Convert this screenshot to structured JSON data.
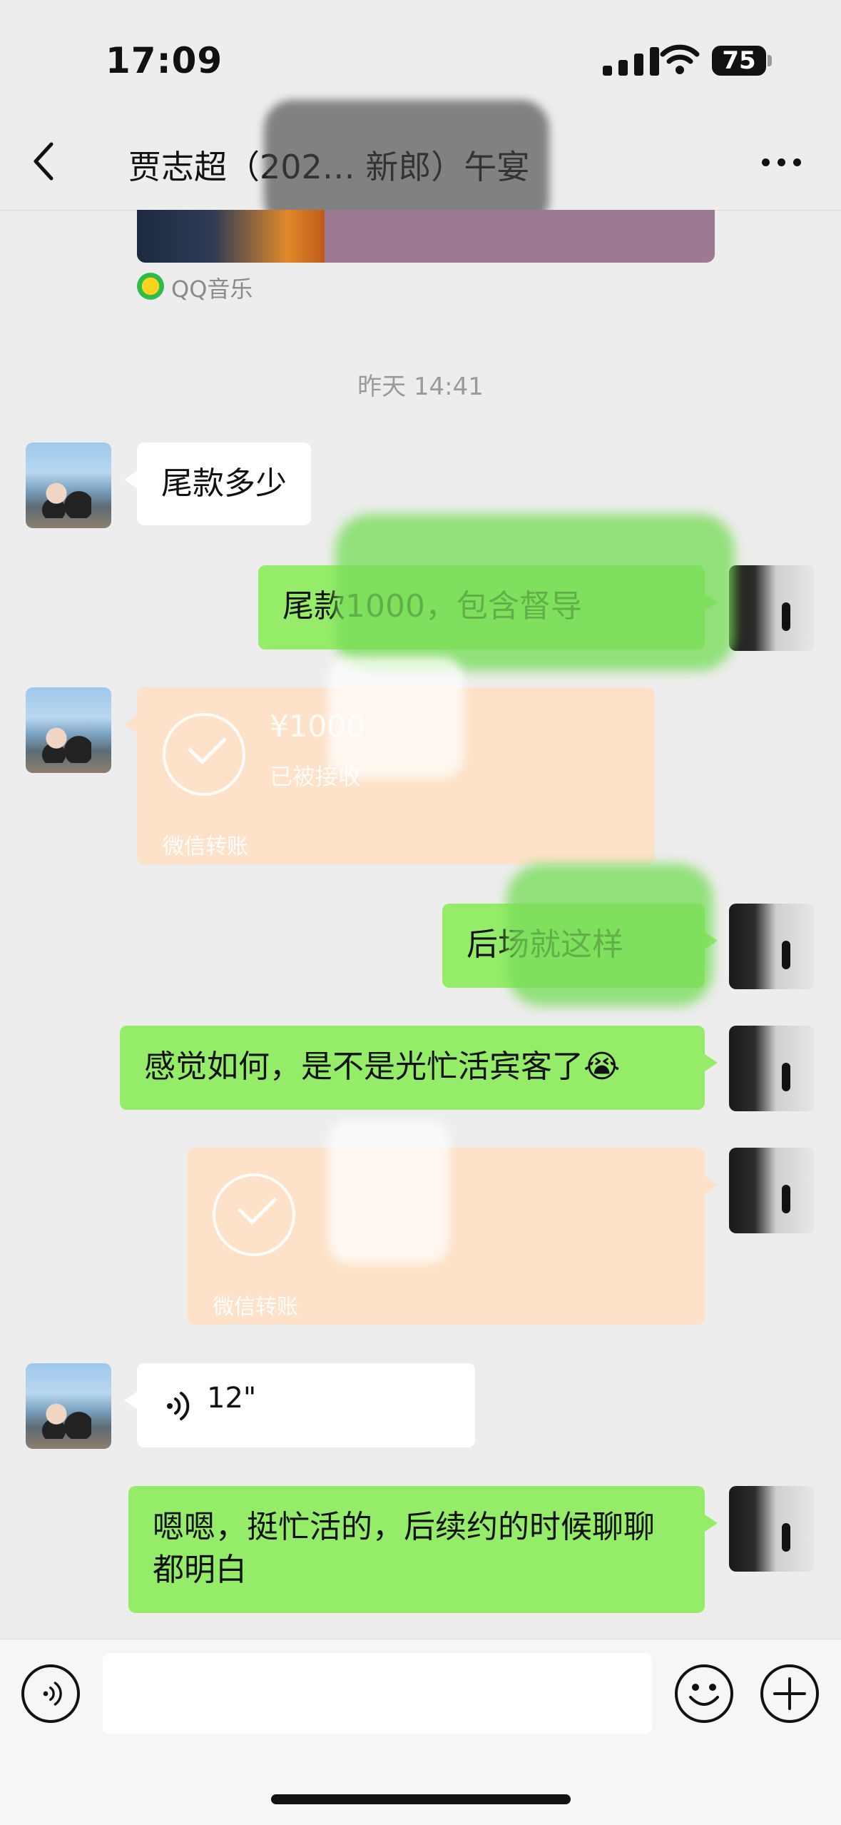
{
  "status_bar": {
    "time": "17:09",
    "battery": "75"
  },
  "nav": {
    "title": "贾志超（202… 新郎）午宴"
  },
  "music_card": {
    "source": "QQ音乐"
  },
  "timestamp": "昨天 14:41",
  "messages": [
    {
      "side": "in",
      "type": "text",
      "text": "尾款多少"
    },
    {
      "side": "out",
      "type": "text",
      "text": "尾款1000，包含督导"
    },
    {
      "side": "in",
      "type": "transfer",
      "amount": "¥1000",
      "status": "已被接收",
      "label": "微信转账"
    },
    {
      "side": "out",
      "type": "text",
      "text": "后场就这样"
    },
    {
      "side": "out",
      "type": "text",
      "text": "感觉如何，是不是光忙活宾客了😭"
    },
    {
      "side": "out",
      "type": "transfer",
      "label": "微信转账"
    },
    {
      "side": "in",
      "type": "voice",
      "duration": "12\""
    },
    {
      "side": "out",
      "type": "text",
      "text": "嗯嗯，挺忙活的，后续约的时候聊聊都明白"
    }
  ],
  "colors": {
    "background": "#ededed",
    "bubble_out": "#95ec69",
    "bubble_in": "#ffffff",
    "transfer": "#fde2c9"
  }
}
